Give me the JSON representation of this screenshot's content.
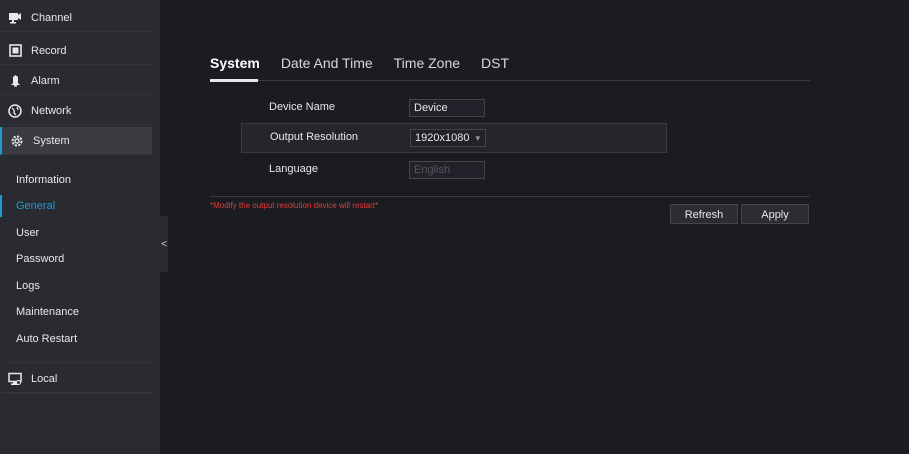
{
  "sidebar": {
    "top_items": [
      {
        "label": "Channel",
        "icon": "camera-icon"
      },
      {
        "label": "Record",
        "icon": "record-icon"
      },
      {
        "label": "Alarm",
        "icon": "alarm-icon"
      },
      {
        "label": "Network",
        "icon": "globe-icon"
      },
      {
        "label": "System",
        "icon": "gear-icon"
      }
    ],
    "sub_items": [
      "Information",
      "General",
      "User",
      "Password",
      "Logs",
      "Maintenance",
      "Auto Restart"
    ],
    "bottom_item": {
      "label": "Local",
      "icon": "monitor-icon"
    },
    "active_sub": "General",
    "collapse_glyph": "<"
  },
  "tabs": [
    "System",
    "Date And Time",
    "Time Zone",
    "DST"
  ],
  "form": {
    "device_name": {
      "label": "Device Name",
      "value": "Device"
    },
    "output_resolution": {
      "label": "Output Resolution",
      "value": "1920x1080"
    },
    "language": {
      "label": "Language",
      "value": "English"
    }
  },
  "warning": "*Modify the output resolution device will restart*",
  "buttons": {
    "refresh": "Refresh",
    "apply": "Apply"
  },
  "colors": {
    "accent": "#1e9bd7",
    "warning": "#e33b3b"
  }
}
